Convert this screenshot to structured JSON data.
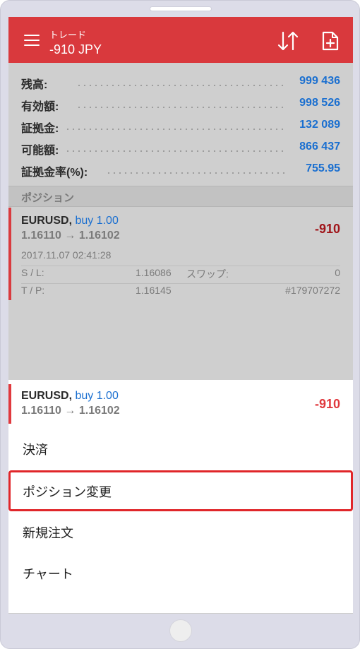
{
  "appbar": {
    "subtitle": "トレード",
    "title": "-910 JPY",
    "icons": {
      "menu": "hamburger-menu-icon",
      "sort": "sort-arrows-icon",
      "new": "new-order-doc-icon"
    }
  },
  "summary": [
    {
      "label": "残高:",
      "value": "999 436"
    },
    {
      "label": "有効額:",
      "value": "998 526"
    },
    {
      "label": "証拠金:",
      "value": "132 089"
    },
    {
      "label": "可能額:",
      "value": "866 437"
    },
    {
      "label": "証拠金率(%):",
      "value": "755.95"
    }
  ],
  "section_title": "ポジション",
  "position": {
    "symbol": "EURUSD,",
    "side": "buy 1.00",
    "prices": "1.16110 → 1.16102",
    "profit": "-910",
    "date": "2017.11.07 02:41:28",
    "sl_label": "S / L:",
    "sl_value": "1.16086",
    "swap_label": "スワップ:",
    "swap_value": "0",
    "tp_label": "T / P:",
    "tp_value": "1.16145",
    "ticket": "#179707272"
  },
  "sheet": {
    "symbol": "EURUSD,",
    "side": "buy 1.00",
    "prices": "1.16110 → 1.16102",
    "profit": "-910",
    "items": [
      {
        "label": "決済"
      },
      {
        "label": "ポジション変更"
      },
      {
        "label": "新規注文"
      },
      {
        "label": "チャート"
      }
    ]
  },
  "colors": {
    "appbar": "#d9393d",
    "value_blue": "#1a6fd0",
    "loss_red": "#e0393e",
    "highlight_red": "#e0262a"
  }
}
